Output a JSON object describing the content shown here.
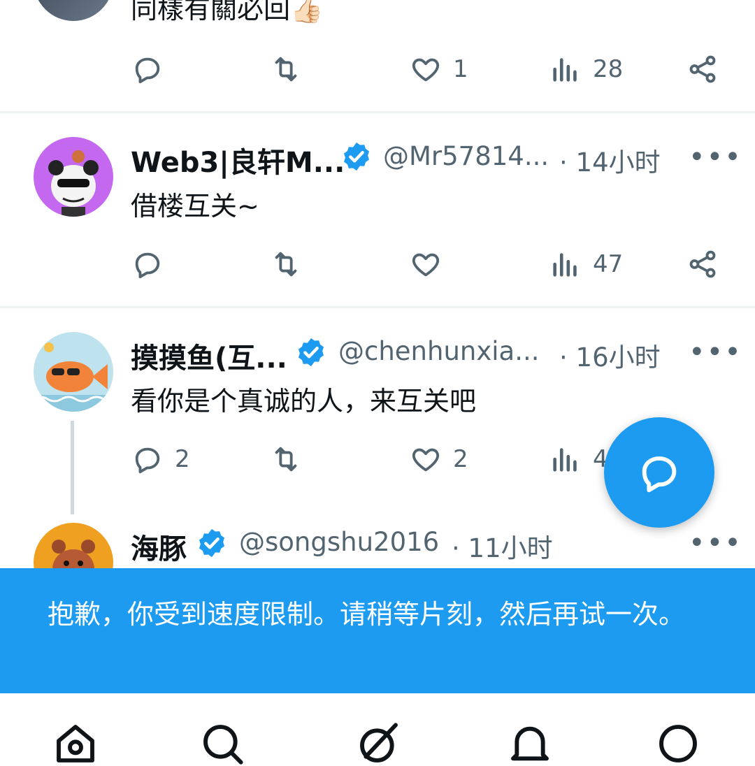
{
  "colors": {
    "accent": "#1d9bf0",
    "icon_gray": "#536471",
    "divider": "#eff3f4"
  },
  "prev_tweet": {
    "text_partial": "同樣有關必回",
    "actions": {
      "reply": "",
      "retweet": "",
      "like": "1",
      "views": "28"
    }
  },
  "tweets": [
    {
      "name": "Web3|良轩M...",
      "handle": "@Mr57814...",
      "time": "· 14小时",
      "text": "借楼互关~",
      "actions": {
        "reply": "",
        "retweet": "",
        "like": "",
        "views": "47"
      }
    },
    {
      "name": "摸摸鱼(互...",
      "handle": "@chenhunxia...",
      "time": "· 16小时",
      "text": "看你是个真诚的人，来互关吧",
      "actions": {
        "reply": "2",
        "retweet": "",
        "like": "2",
        "views": "4"
      }
    },
    {
      "name": "海豚",
      "handle": "@songshu2016",
      "time": "· 11小时"
    }
  ],
  "more_label": "•••",
  "toast": {
    "text": "抱歉，你受到速度限制。请稍等片刻，然后再试一次。"
  },
  "fab": {
    "icon": "reply-bubble-icon"
  },
  "nav": [
    "home-icon",
    "search-icon",
    "grok-icon",
    "notifications-icon",
    "messages-icon"
  ]
}
